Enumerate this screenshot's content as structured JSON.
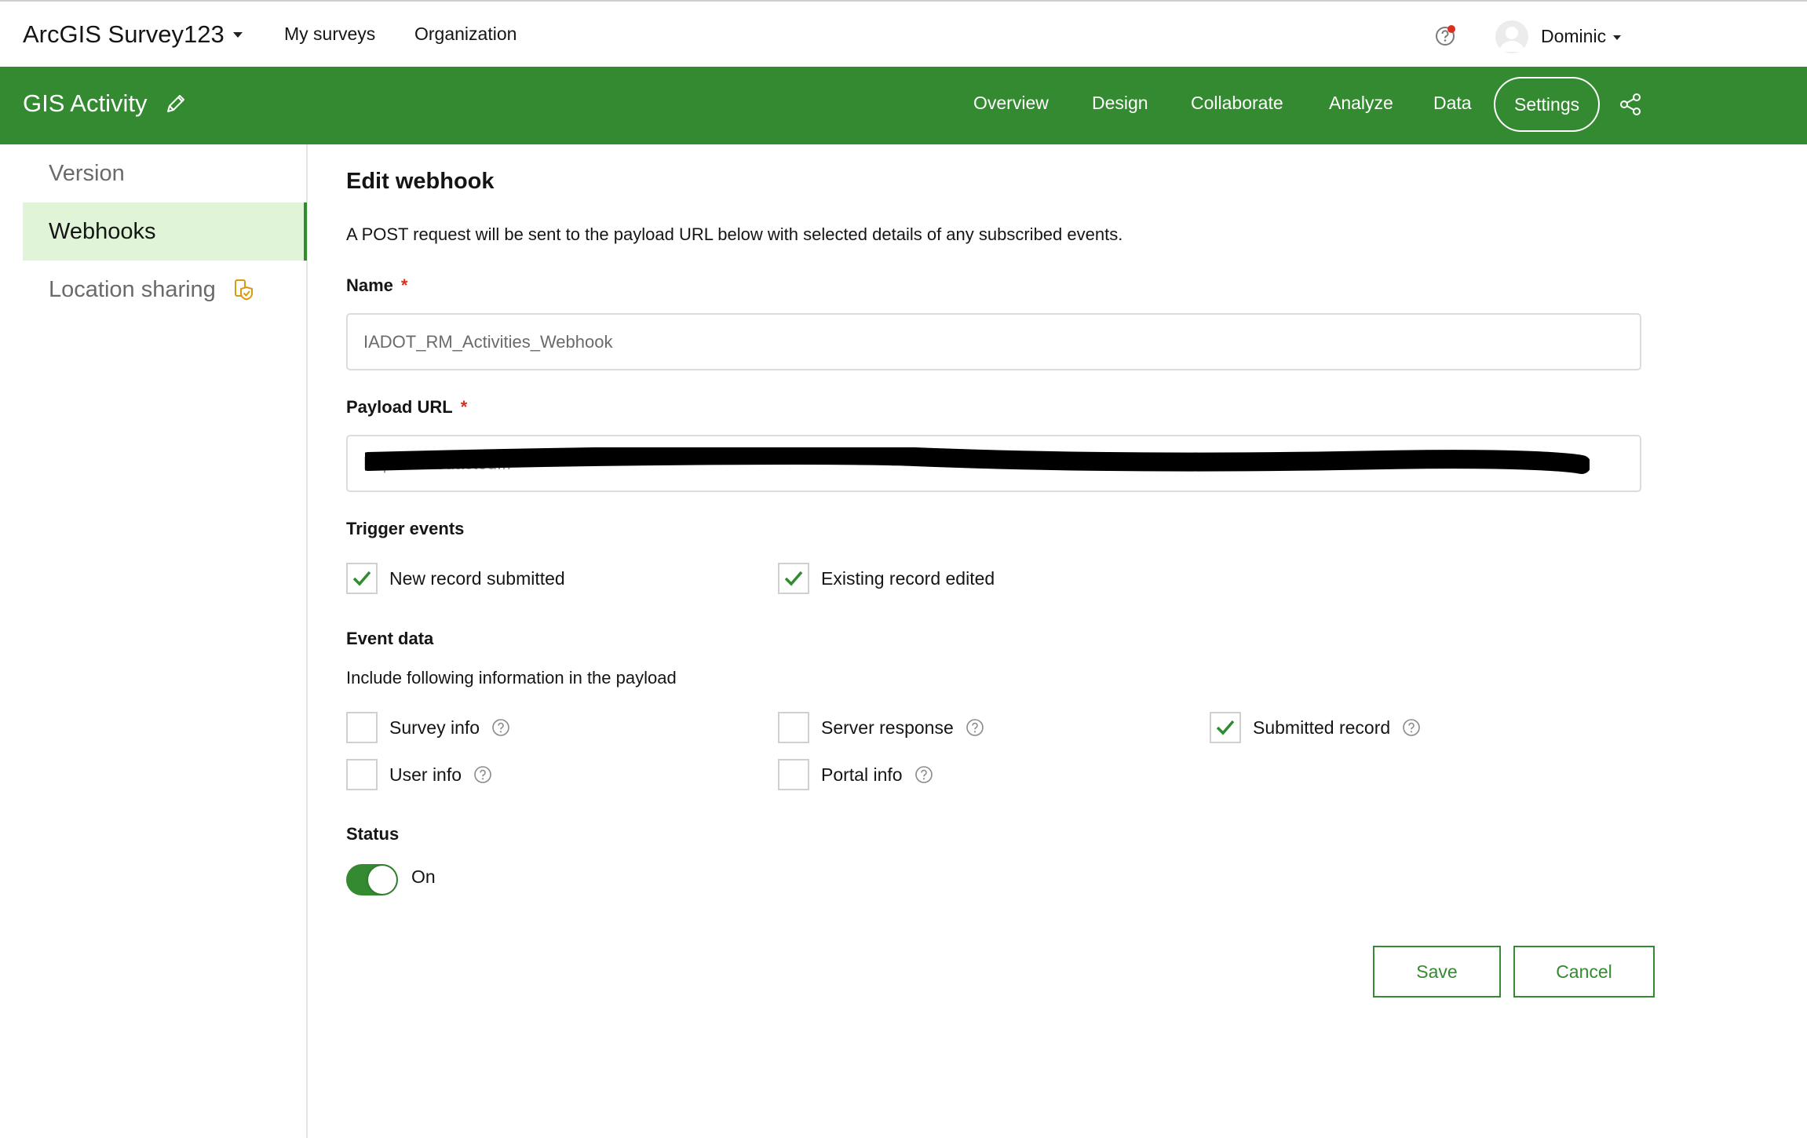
{
  "app": {
    "title": "ArcGIS Survey123"
  },
  "topnav": {
    "my_surveys": "My surveys",
    "organization": "Organization"
  },
  "user": {
    "name": "Dominic"
  },
  "survey": {
    "title": "GIS Activity"
  },
  "tabs": [
    "Overview",
    "Design",
    "Collaborate",
    "Analyze",
    "Data",
    "Settings"
  ],
  "active_tab": "Settings",
  "sidebar": {
    "items": [
      {
        "label": "Version"
      },
      {
        "label": "Webhooks"
      },
      {
        "label": "Location sharing"
      }
    ],
    "active": "Webhooks"
  },
  "form": {
    "title": "Edit webhook",
    "description": "A POST request will be sent to the payload URL below with selected details of any subscribed events.",
    "name_label": "Name",
    "name_value": "IADOT_RM_Activities_Webhook",
    "url_label": "Payload URL",
    "url_value": "https://...redacted...",
    "required_marker": "*",
    "trigger_label": "Trigger events",
    "triggers": [
      {
        "label": "New record submitted",
        "checked": true
      },
      {
        "label": "Existing record edited",
        "checked": true
      }
    ],
    "event_data_label": "Event data",
    "event_data_desc": "Include following information in the payload",
    "event_data": [
      {
        "label": "Survey info",
        "checked": false
      },
      {
        "label": "Server response",
        "checked": false
      },
      {
        "label": "Submitted record",
        "checked": true
      },
      {
        "label": "User info",
        "checked": false
      },
      {
        "label": "Portal info",
        "checked": false
      }
    ],
    "status_label": "Status",
    "status_value": "On",
    "save_label": "Save",
    "cancel_label": "Cancel"
  },
  "colors": {
    "brand_green": "#338a30",
    "active_sidebar_bg": "#e0f4d8",
    "required_red": "#d83020",
    "notification_dot": "#d83020"
  },
  "icons": {
    "app_dropdown": "chevron-down-icon",
    "help": "help-icon",
    "avatar": "avatar",
    "edit": "pencil-icon",
    "share": "share-icon",
    "location_badge": "shield-icon",
    "checkbox_check": "check-icon",
    "info": "question-circle-icon"
  }
}
